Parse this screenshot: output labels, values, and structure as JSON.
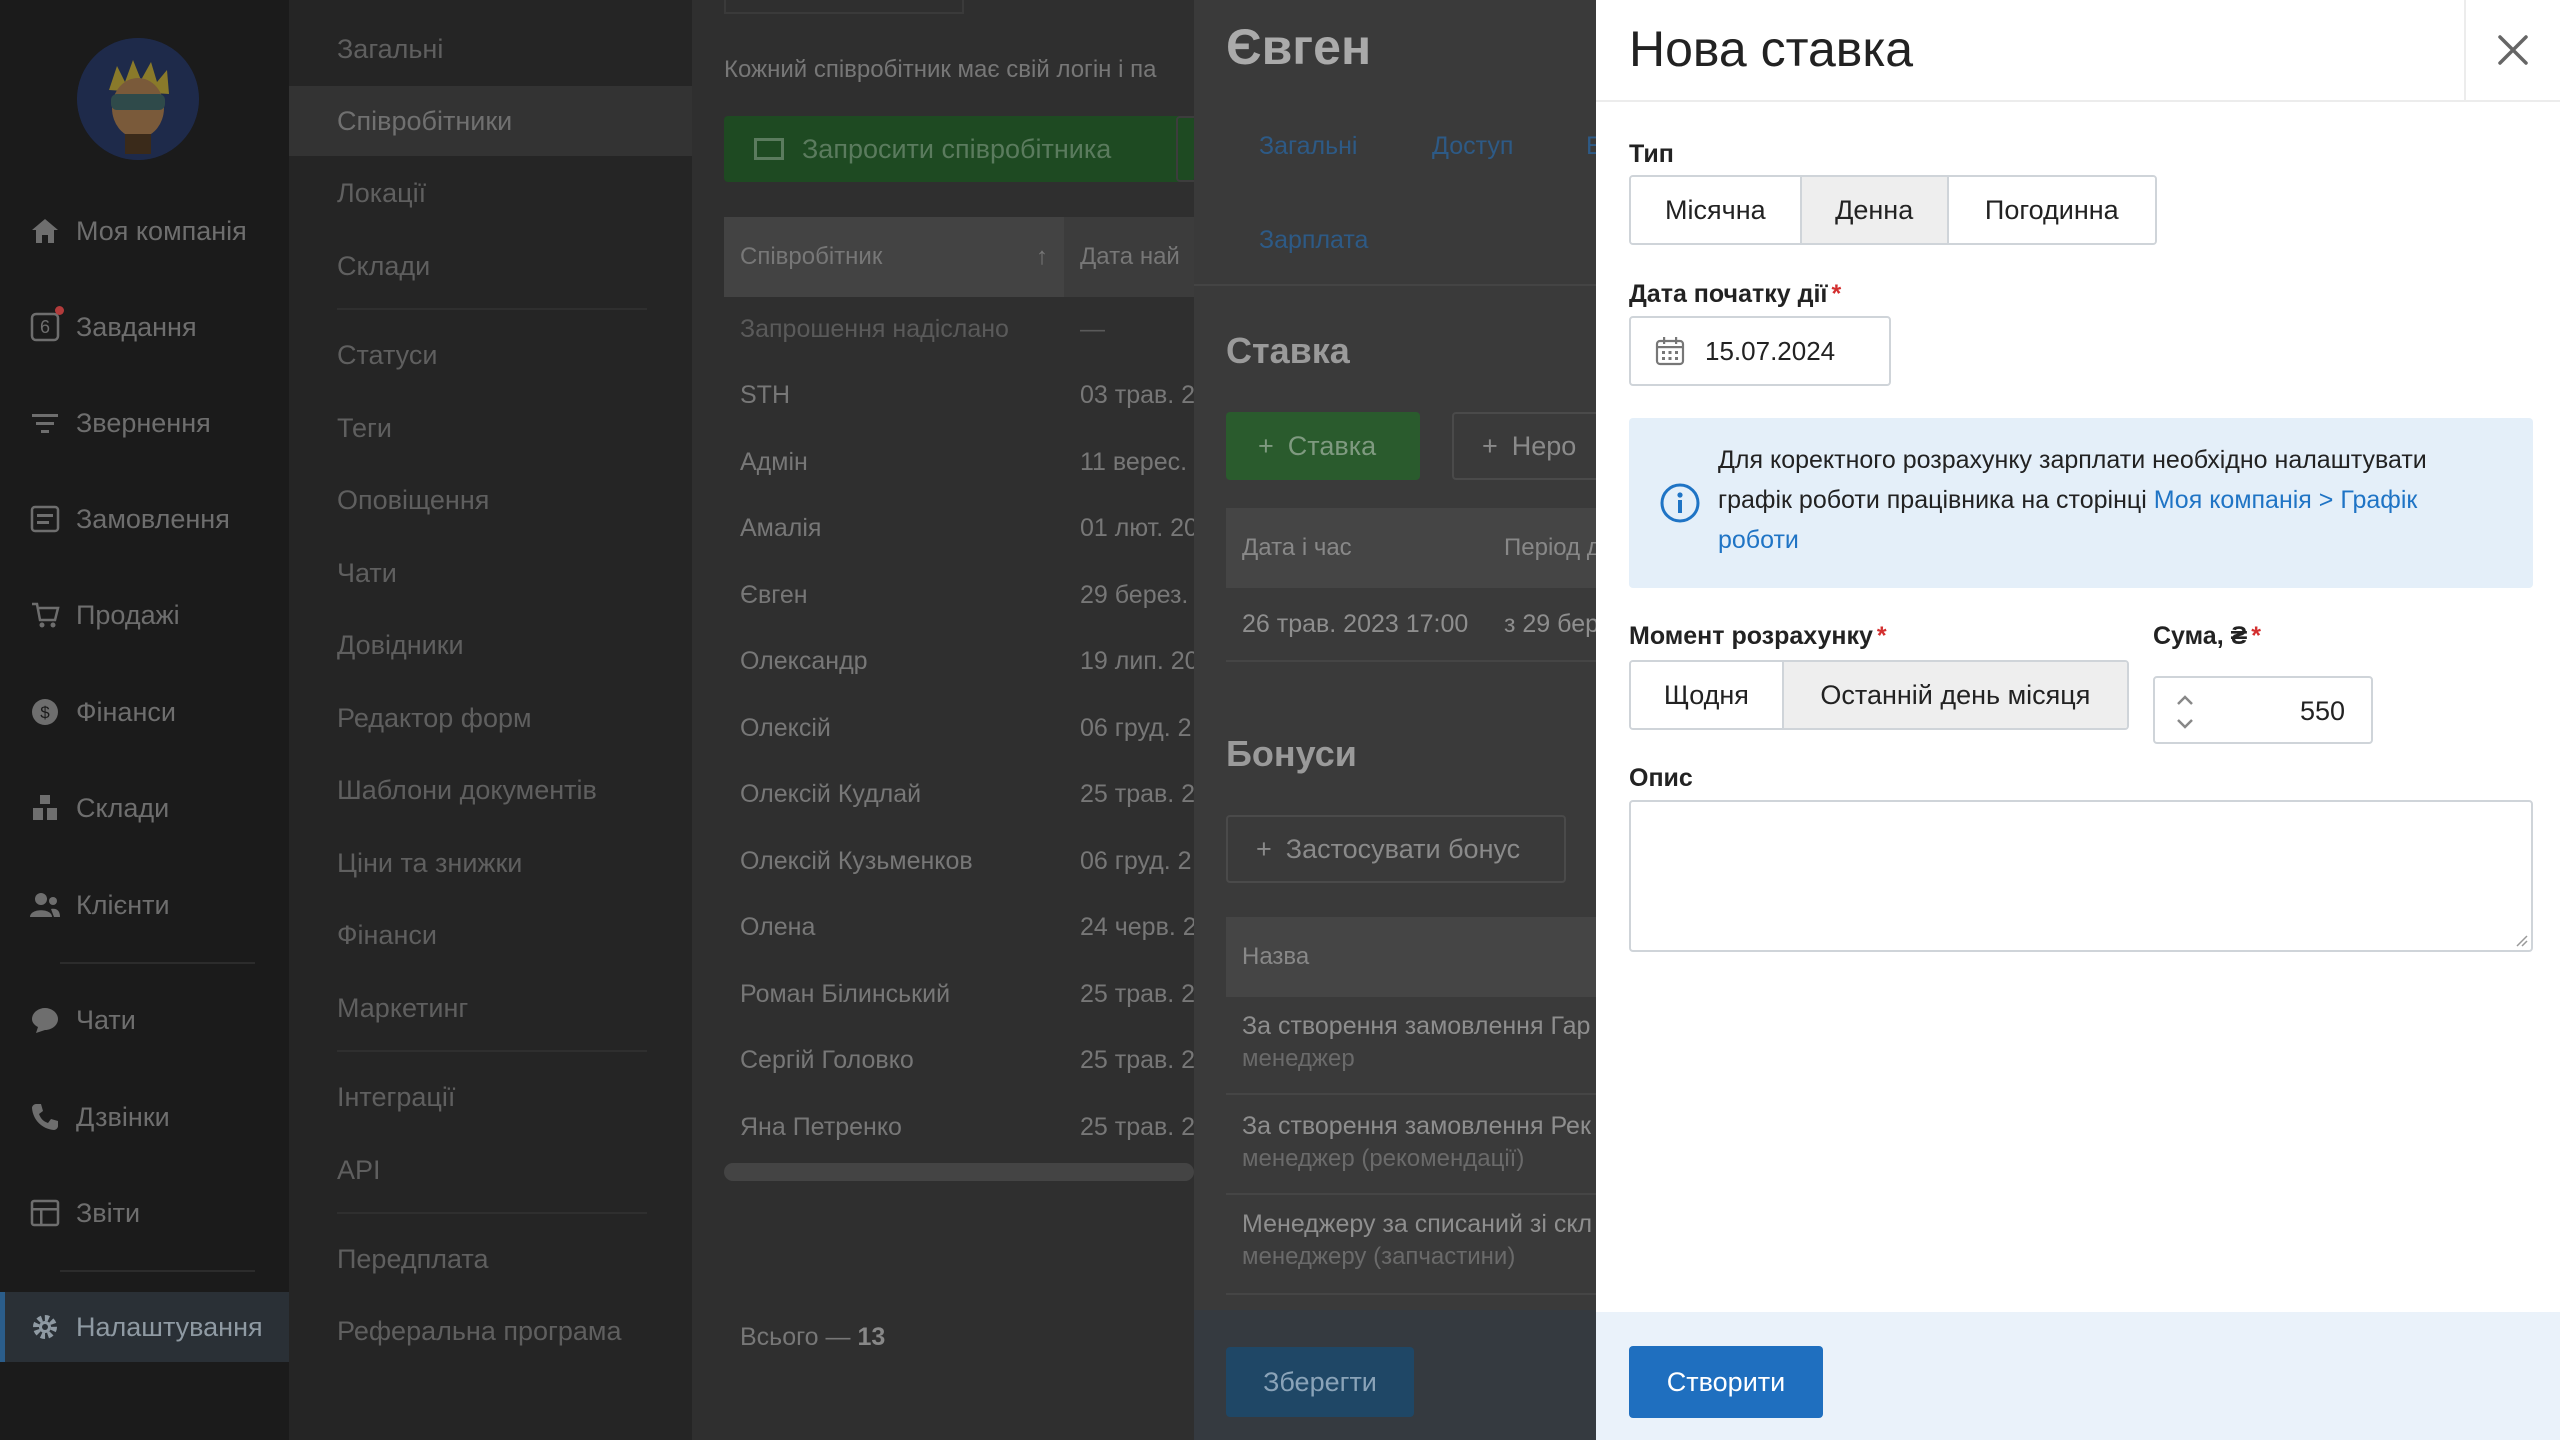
{
  "sidebar": {
    "items": [
      {
        "label": "Моя компанія",
        "icon": "home-icon"
      },
      {
        "label": "Завдання",
        "icon": "tasks-icon",
        "badge": "6"
      },
      {
        "label": "Звернення",
        "icon": "funnel-icon"
      },
      {
        "label": "Замовлення",
        "icon": "orders-icon"
      },
      {
        "label": "Продажі",
        "icon": "cart-icon"
      },
      {
        "label": "Фінанси",
        "icon": "dollar-icon"
      },
      {
        "label": "Склади",
        "icon": "warehouse-icon"
      },
      {
        "label": "Клієнти",
        "icon": "clients-icon"
      },
      {
        "label": "Чати",
        "icon": "chat-icon"
      },
      {
        "label": "Дзвінки",
        "icon": "phone-icon"
      },
      {
        "label": "Звіти",
        "icon": "reports-icon"
      },
      {
        "label": "Налаштування",
        "icon": "gear-icon"
      }
    ]
  },
  "submenu": {
    "items": [
      "Загальні",
      "Співробітники",
      "Локації",
      "Склади",
      "Статуси",
      "Теги",
      "Оповіщення",
      "Чати",
      "Довідники",
      "Редактор форм",
      "Шаблони документів",
      "Ціни та знижки",
      "Фінанси",
      "Маркетинг",
      "Інтеграції",
      "API",
      "Передплата",
      "Реферальна програма"
    ]
  },
  "employees": {
    "hint": "Кожний співробітник має свій логін і па",
    "invite_button": "Запросити співробітника",
    "columns": [
      "Співробітник",
      "Дата най"
    ],
    "rows": [
      {
        "name": "Запрошення надіслано",
        "date": "—"
      },
      {
        "name": "STH",
        "date": "03 трав. 2"
      },
      {
        "name": "Адмін",
        "date": "11 верес."
      },
      {
        "name": "Амалія",
        "date": "01 лют. 20"
      },
      {
        "name": "Євген",
        "date": "29 берез."
      },
      {
        "name": "Олександр",
        "date": "19 лип. 20"
      },
      {
        "name": "Олексій",
        "date": "06 груд. 2"
      },
      {
        "name": "Олексій Кудлай",
        "date": "25 трав. 2"
      },
      {
        "name": "Олексій Кузьменков",
        "date": "06 груд. 2"
      },
      {
        "name": "Олена",
        "date": "24 черв. 2"
      },
      {
        "name": "Роман Білинський",
        "date": "25 трав. 2"
      },
      {
        "name": "Сергій Головко",
        "date": "25 трав. 2"
      },
      {
        "name": "Яна Петренко",
        "date": "25 трав. 2"
      }
    ],
    "total_label": "Всього —",
    "total_value": "13"
  },
  "employee": {
    "name": "Євген",
    "tabs": [
      "Загальні",
      "Доступ",
      "Е",
      "Зарплата"
    ],
    "rate_heading": "Ставка",
    "rate_button": "Ставка",
    "nonwork_button": "Неро",
    "rate_columns": [
      "Дата і час",
      "Період д"
    ],
    "rate_row": {
      "date": "26 трав. 2023 17:00",
      "period": "з 29 бер"
    },
    "bonus_heading": "Бонуси",
    "bonus_button": "Застосувати бонус",
    "bonus_column": "Назва",
    "bonuses": [
      {
        "title": "За створення замовлення Гар",
        "sub": "менеджер"
      },
      {
        "title": "За створення замовлення Рек",
        "sub": "менеджер (рекомендації)"
      },
      {
        "title": "Менеджеру за списаний зі скл",
        "sub": "менеджеру (запчастини)"
      }
    ],
    "save_button": "Зберегти"
  },
  "modal": {
    "title": "Нова ставка",
    "type_label": "Тип",
    "type_options": [
      "Місячна",
      "Денна",
      "Погодинна"
    ],
    "type_selected": "Денна",
    "start_date_label": "Дата початку дії",
    "start_date_value": "15.07.2024",
    "info_text": "Для коректного розрахунку зарплати необхідно налаштувати графік роботи працівника на сторінці ",
    "info_link": "Моя компанія > Графік роботи",
    "moment_label": "Момент розрахунку",
    "moment_options": [
      "Щодня",
      "Останній день місяця"
    ],
    "moment_selected": "Останній день місяця",
    "sum_label": "Сума, ₴",
    "sum_value": "550",
    "description_label": "Опис",
    "description_value": "",
    "create_button": "Створити"
  },
  "colors": {
    "primary": "#1f6fbf",
    "required": "#d32f2f",
    "info_bg": "#e4eff9",
    "link": "#1f74c5"
  }
}
